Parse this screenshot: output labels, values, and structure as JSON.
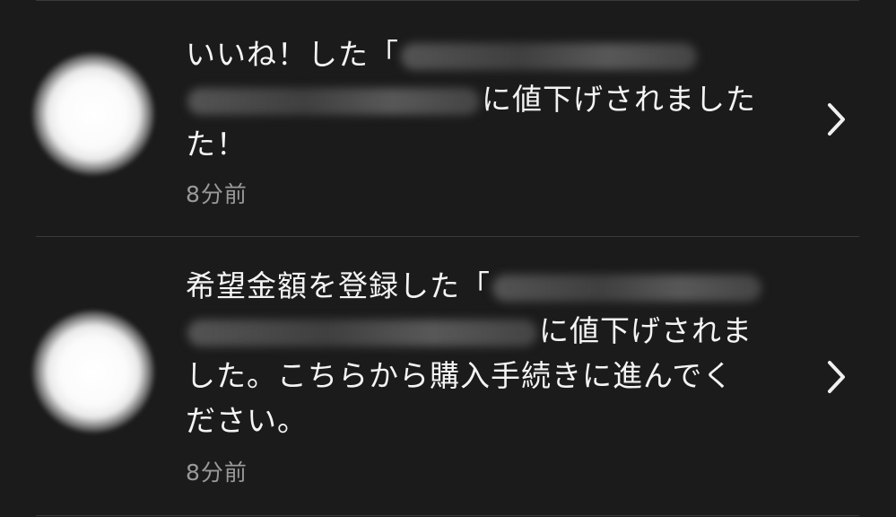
{
  "notifications": [
    {
      "lead_text": "いいね！した「",
      "action_text": "に値下げされました",
      "tail_text": "た！",
      "timestamp": "8分前",
      "chevron": "chevron-right-icon"
    },
    {
      "lead_text": "希望金額を登録した「",
      "action_text": "に値下げされま",
      "tail_text": "した。こちらから購入手続きに進んでく",
      "tail_text_2": "ださい。",
      "timestamp": "8分前",
      "chevron": "chevron-right-icon"
    }
  ]
}
